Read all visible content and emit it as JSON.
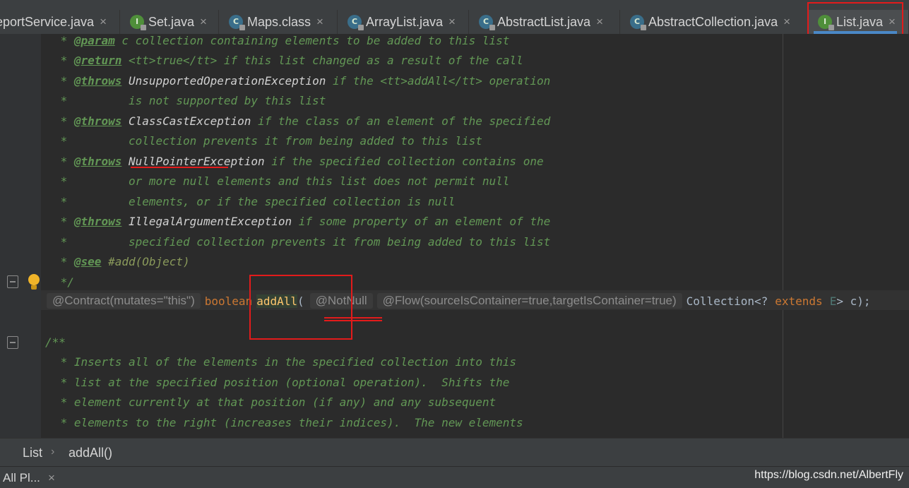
{
  "tabs": [
    {
      "label": "eportService.java",
      "kind": "none"
    },
    {
      "label": "Set.java",
      "kind": "interface"
    },
    {
      "label": "Maps.class",
      "kind": "class"
    },
    {
      "label": "ArrayList.java",
      "kind": "class"
    },
    {
      "label": "AbstractList.java",
      "kind": "class"
    },
    {
      "label": "AbstractCollection.java",
      "kind": "class"
    },
    {
      "label": "List.java",
      "kind": "interface",
      "active": true
    }
  ],
  "tab_close_glyph": "×",
  "editor": {
    "javadoc_top": [
      {
        "pre": " * ",
        "tag": "@param",
        "rest": " c collection containing elements to be added to this list"
      },
      {
        "pre": " * ",
        "tag": "@return",
        "rest": " <tt>true</tt> if this list changed as a result of the call"
      },
      {
        "pre": " * ",
        "tag": "@throws",
        "type": " UnsupportedOperationException",
        "rest": " if the <tt>addAll</tt> operation"
      },
      {
        "pre": " *         ",
        "rest": "is not supported by this list"
      },
      {
        "pre": " * ",
        "tag": "@throws",
        "type": " ClassCastException",
        "rest": " if the class of an element of the specified"
      },
      {
        "pre": " *         ",
        "rest": "collection prevents it from being added to this list"
      },
      {
        "pre": " * ",
        "tag": "@throws",
        "type": " NullPointerException",
        "rest": " if the specified collection contains one"
      },
      {
        "pre": " *         ",
        "rest": "or more null elements and this list does not permit null"
      },
      {
        "pre": " *         ",
        "rest": "elements, or if the specified collection is null"
      },
      {
        "pre": " * ",
        "tag": "@throws",
        "type": " IllegalArgumentException",
        "rest": " if some property of an element of the"
      },
      {
        "pre": " *         ",
        "rest": "specified collection prevents it from being added to this list"
      },
      {
        "pre": " * ",
        "tag": "@see",
        "rest": " #add(Object)"
      },
      {
        "pre": " */",
        "rest": ""
      }
    ],
    "declaration": {
      "contract": "@Contract(mutates=\"this\")",
      "keyword": "boolean",
      "method": "addAll",
      "open": "(",
      "notnull": "@NotNull",
      "flow": "@Flow(sourceIsContainer=true,targetIsContainer=true)",
      "ptype": "Collection",
      "generic_open": "<?",
      "extends": "extends",
      "tvar": "E",
      "tail": "> c);"
    },
    "javadoc_bottom": [
      "/**",
      " * Inserts all of the elements in the specified collection into this",
      " * list at the specified position (optional operation).  Shifts the",
      " * element currently at that position (if any) and any subsequent",
      " * elements to the right (increases their indices).  The new elements"
    ]
  },
  "breadcrumb": {
    "class_name": "List",
    "method": "addAll()"
  },
  "bottom": {
    "tool_window": "All Pl...",
    "close": "×",
    "watermark": "https://blog.csdn.net/AlbertFly"
  },
  "colors": {
    "comment": "#629755",
    "keyword": "#cc7832",
    "method": "#ffc66d",
    "annotation_box": "#e21b1b",
    "active_tab_underline": "#4a88c7"
  }
}
